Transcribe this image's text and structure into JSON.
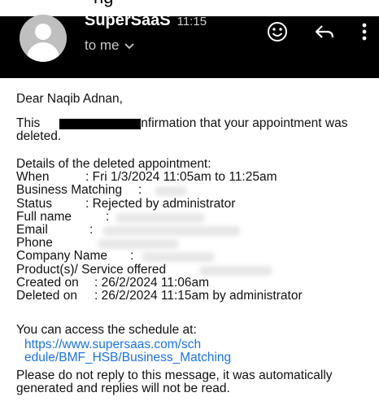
{
  "sender": {
    "name": "SuperSaaS",
    "time": "11:15",
    "to_label": "to me"
  },
  "top_clipped_text": "ng",
  "icons": {
    "avatar": "avatar-icon",
    "emoji": "smiley-icon",
    "reply": "reply-icon",
    "more": "more-vert-icon",
    "chevron": "chevron-down-icon"
  },
  "email": {
    "greeting": "Dear Naqib Adnan,",
    "intro_part1": "This",
    "intro_part2": "nfirmation that your appointment was",
    "intro_line2": "deleted.",
    "details_heading": "Details of the deleted appointment:",
    "details": [
      {
        "label": "When",
        "value": ": Fri 1/3/2024 11:05am to 11:25am"
      },
      {
        "label": "Business Matching",
        "value": ":"
      },
      {
        "label": "Status",
        "value": ": Rejected by administrator"
      },
      {
        "label": "Full name",
        "value": ":"
      },
      {
        "label": "Email",
        "value": ":"
      },
      {
        "label": "Phone",
        "value": ""
      },
      {
        "label": "Company Name",
        "value": ":"
      },
      {
        "label": "Product(s)/ Service offered",
        "value": ""
      },
      {
        "label": "Created on",
        "value": ": 26/2/2024 11:06am"
      },
      {
        "label": "Deleted on",
        "value": ": 26/2/2024 11:15am by administrator"
      }
    ],
    "access_text": "You can access the schedule at:",
    "link_line1": "https://www.supersaas.com/sch",
    "link_line2": "edule/BMF_HSB/Business_Matching",
    "footer_line1": "Please do not reply to this message, it was automatically",
    "footer_line2": "generated and replies will not be read."
  },
  "colors": {
    "header_bg": "#000000",
    "link": "#1a73e8",
    "avatar_bg": "#bfbfbf"
  }
}
